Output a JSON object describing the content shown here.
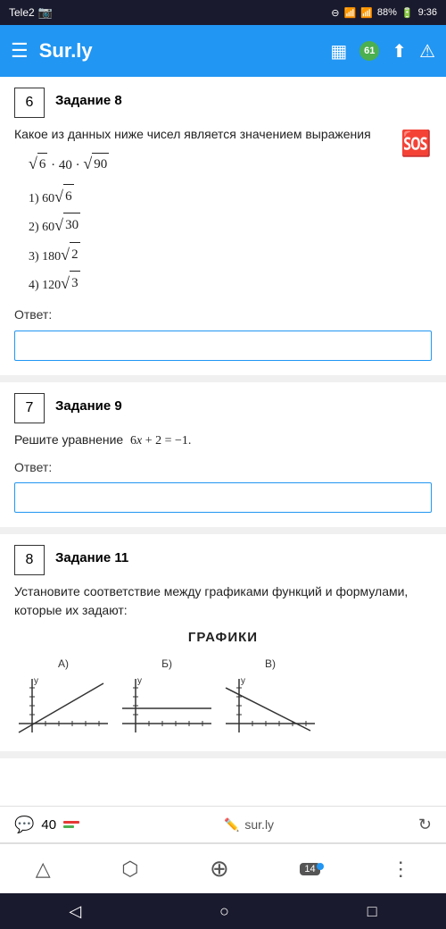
{
  "statusBar": {
    "carrier": "Tele2",
    "signal_icon": "signal-bars",
    "wifi_icon": "wifi",
    "battery": "88%",
    "time": "9:36"
  },
  "navBar": {
    "menu_icon": "menu",
    "title": "Sur.ly",
    "notification_count": "61",
    "share_icon": "share",
    "warning_icon": "warning"
  },
  "tasks": [
    {
      "number": "6",
      "label": "Задание 8",
      "question": "Какое из данных ниже чисел является значением выражения",
      "formula": "√6 · 40 · √90",
      "options": [
        "1) 60√6",
        "2) 60√30",
        "3) 180√2",
        "4) 120√3"
      ],
      "answer_label": "Ответ:",
      "answer_placeholder": ""
    },
    {
      "number": "7",
      "label": "Задание 9",
      "question": "Решите уравнение  6x + 2 = −1.",
      "answer_label": "Ответ:",
      "answer_placeholder": ""
    },
    {
      "number": "8",
      "label": "Задание 11",
      "question": "Установите соответствие между графиками функций и формулами, которые их задают:",
      "graphs_title": "ГРАФИКИ",
      "graph_labels": [
        "А)",
        "Б)",
        "В)"
      ]
    }
  ],
  "bottomBar": {
    "chat_count": "40",
    "site": "sur.ly",
    "refresh_icon": "refresh"
  },
  "bottomNav": {
    "items": [
      {
        "icon": "△",
        "label": "",
        "name": "home"
      },
      {
        "icon": "⬡",
        "label": "",
        "name": "share"
      },
      {
        "icon": "⊕",
        "label": "",
        "name": "add"
      },
      {
        "icon": "14",
        "label": "",
        "name": "count",
        "badge": true
      },
      {
        "icon": "⋮",
        "label": "",
        "name": "more"
      }
    ]
  },
  "androidNav": {
    "back": "◁",
    "home": "○",
    "recent": "□"
  }
}
